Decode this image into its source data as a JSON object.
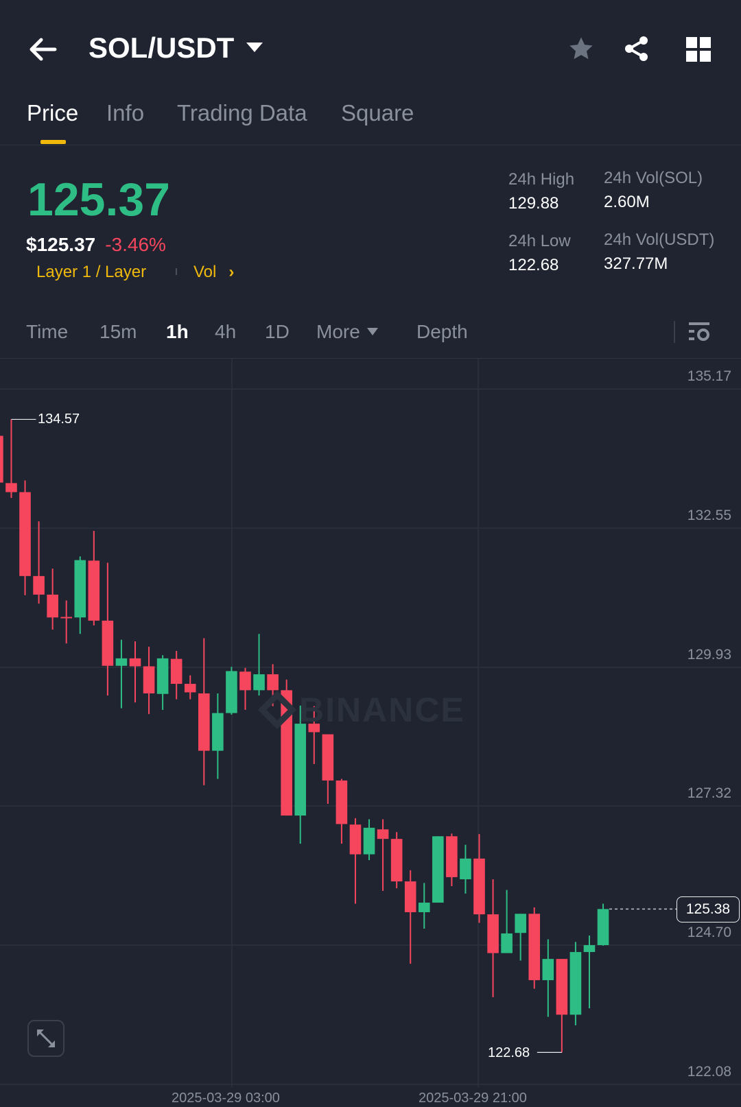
{
  "header": {
    "pair": "SOL/USDT"
  },
  "tabs": [
    {
      "label": "Price",
      "active": true
    },
    {
      "label": "Info"
    },
    {
      "label": "Trading Data"
    },
    {
      "label": "Square"
    }
  ],
  "ticker": {
    "last_price": "125.37",
    "usd_price": "$125.37",
    "change": "-3.46%",
    "tag": "Layer 1 / Layer",
    "vol_link": "Vol",
    "high_label": "24h High",
    "high": "129.88",
    "low_label": "24h Low",
    "low": "122.68",
    "vol_sol_label": "24h Vol(SOL)",
    "vol_sol": "2.60M",
    "vol_usdt_label": "24h Vol(USDT)",
    "vol_usdt": "327.77M"
  },
  "intervals": [
    {
      "label": "Time"
    },
    {
      "label": "15m"
    },
    {
      "label": "1h",
      "active": true
    },
    {
      "label": "4h"
    },
    {
      "label": "1D"
    },
    {
      "label": "More"
    },
    {
      "label": "Depth"
    }
  ],
  "colors": {
    "up": "#2ebd85",
    "down": "#f6465d",
    "accent": "#f0b90b",
    "bg": "#1f2430"
  },
  "chart_data": {
    "type": "candlestick",
    "watermark": "BINANCE",
    "y_ticks": [
      "135.17",
      "132.55",
      "129.93",
      "127.32",
      "124.70",
      "122.08"
    ],
    "ylim": [
      122.08,
      135.17
    ],
    "x_ticks": [
      "2025-03-29 03:00",
      "2025-03-29 21:00"
    ],
    "high_marker": "134.57",
    "low_marker": "122.68",
    "current_price": "125.38",
    "candles": [
      [
        134.29,
        134.29,
        133.41,
        133.41
      ],
      [
        133.4,
        134.6,
        133.12,
        133.23
      ],
      [
        133.23,
        133.45,
        131.29,
        131.65
      ],
      [
        131.65,
        132.68,
        131.13,
        131.3
      ],
      [
        131.3,
        131.79,
        130.64,
        130.87
      ],
      [
        130.88,
        131.19,
        130.38,
        130.87
      ],
      [
        130.87,
        132.02,
        130.56,
        131.95
      ],
      [
        131.94,
        132.5,
        130.72,
        130.81
      ],
      [
        130.81,
        131.9,
        129.4,
        129.96
      ],
      [
        129.96,
        130.45,
        129.16,
        130.1
      ],
      [
        130.1,
        130.42,
        129.27,
        129.95
      ],
      [
        129.95,
        130.32,
        129.05,
        129.44
      ],
      [
        129.43,
        130.16,
        129.13,
        130.1
      ],
      [
        130.09,
        130.24,
        129.33,
        129.62
      ],
      [
        129.62,
        129.78,
        129.33,
        129.46
      ],
      [
        129.44,
        130.48,
        127.71,
        128.36
      ],
      [
        128.36,
        129.44,
        127.83,
        129.07
      ],
      [
        129.07,
        129.94,
        129.04,
        129.86
      ],
      [
        129.85,
        129.92,
        129.13,
        129.5
      ],
      [
        129.5,
        130.56,
        129.4,
        129.8
      ],
      [
        129.8,
        129.99,
        129.2,
        129.5
      ],
      [
        129.5,
        129.7,
        127.14,
        127.14
      ],
      [
        127.14,
        129.21,
        126.61,
        128.87
      ],
      [
        128.87,
        129.2,
        128.11,
        128.71
      ],
      [
        128.67,
        128.67,
        127.36,
        127.8
      ],
      [
        127.8,
        127.83,
        126.61,
        126.98
      ],
      [
        126.97,
        127.09,
        125.48,
        126.41
      ],
      [
        126.41,
        127.07,
        126.3,
        126.91
      ],
      [
        126.88,
        127.07,
        125.72,
        126.7
      ],
      [
        126.7,
        126.83,
        125.77,
        125.9
      ],
      [
        125.9,
        126.11,
        124.35,
        125.32
      ],
      [
        125.32,
        125.87,
        125.01,
        125.5
      ],
      [
        125.5,
        126.75,
        125.5,
        126.75
      ],
      [
        126.75,
        126.8,
        125.81,
        125.98
      ],
      [
        125.94,
        126.59,
        125.67,
        126.33
      ],
      [
        126.33,
        126.79,
        125.12,
        125.28
      ],
      [
        125.28,
        125.94,
        123.72,
        124.55
      ],
      [
        124.55,
        125.74,
        124.68,
        124.92
      ],
      [
        124.93,
        125.29,
        124.41,
        125.29
      ],
      [
        125.29,
        125.41,
        123.88,
        124.04
      ],
      [
        124.04,
        124.81,
        123.35,
        124.44
      ],
      [
        124.44,
        124.44,
        122.68,
        123.39
      ],
      [
        123.39,
        124.76,
        123.19,
        124.57
      ],
      [
        124.57,
        124.88,
        123.51,
        124.7
      ],
      [
        124.7,
        125.48,
        124.69,
        125.38
      ]
    ],
    "candle_format": [
      "open",
      "high",
      "low",
      "close"
    ]
  }
}
